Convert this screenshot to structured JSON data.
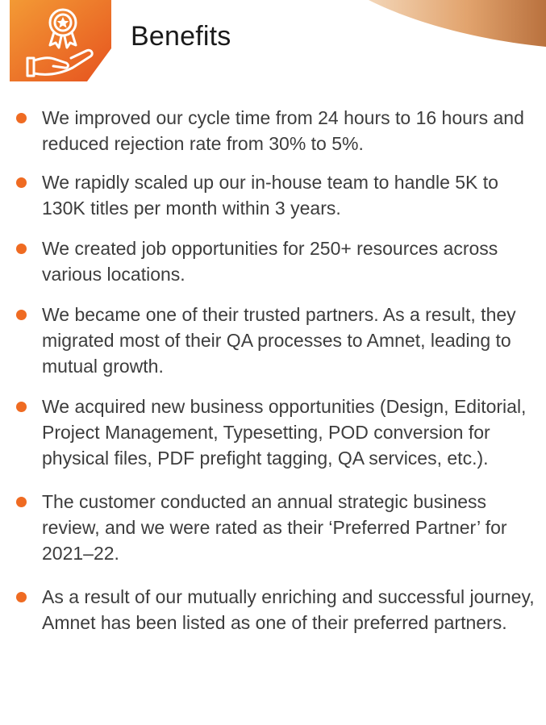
{
  "page": {
    "title": "Benefits"
  },
  "badge": {
    "icon": "award-hand-icon",
    "color_from": "#f18a2c",
    "color_to": "#e9581f"
  },
  "accent": "#ef6b22",
  "benefits": [
    "We improved our cycle time from 24 hours to 16 hours and reduced rejection rate from 30% to 5%.",
    "We rapidly scaled up our in-house team to handle 5K to 130K titles per month within 3 years.",
    "We created job opportunities for 250+ resources across various locations.",
    "We became one of their trusted partners. As a result, they migrated most of their QA processes to Amnet, leading to mutual growth.",
    "We acquired new business opportunities (Design, Editorial, Project Management, Typesetting, POD conversion for physical files, PDF prefight tagging, QA services, etc.).",
    "The customer conducted an annual strategic business review, and we were rated as their ‘Preferred Partner’ for 2021–22.",
    "As a result of our mutually enriching and successful journey, Amnet has been listed as one of their preferred partners."
  ]
}
